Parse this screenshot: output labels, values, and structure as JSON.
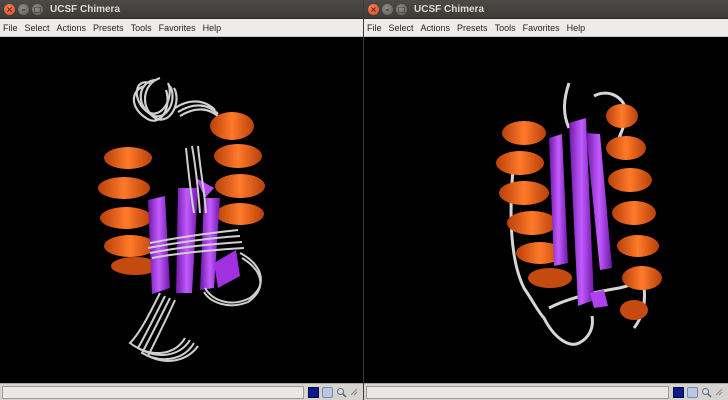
{
  "windows": [
    {
      "title": "UCSF Chimera",
      "menu": [
        "File",
        "Select",
        "Actions",
        "Presets",
        "Tools",
        "Favorites",
        "Help"
      ],
      "status_text": ""
    },
    {
      "title": "UCSF Chimera",
      "menu": [
        "File",
        "Select",
        "Actions",
        "Presets",
        "Tools",
        "Favorites",
        "Help"
      ],
      "status_text": ""
    }
  ],
  "colors": {
    "helix": "#f0621a",
    "strand": "#a330e8",
    "coil": "#d8d8d8",
    "background": "#000000"
  },
  "icons": [
    "close-icon",
    "minimize-icon",
    "maximize-icon",
    "command-line-icon",
    "idle-icon",
    "magnifier-icon",
    "resize-grip-icon"
  ]
}
